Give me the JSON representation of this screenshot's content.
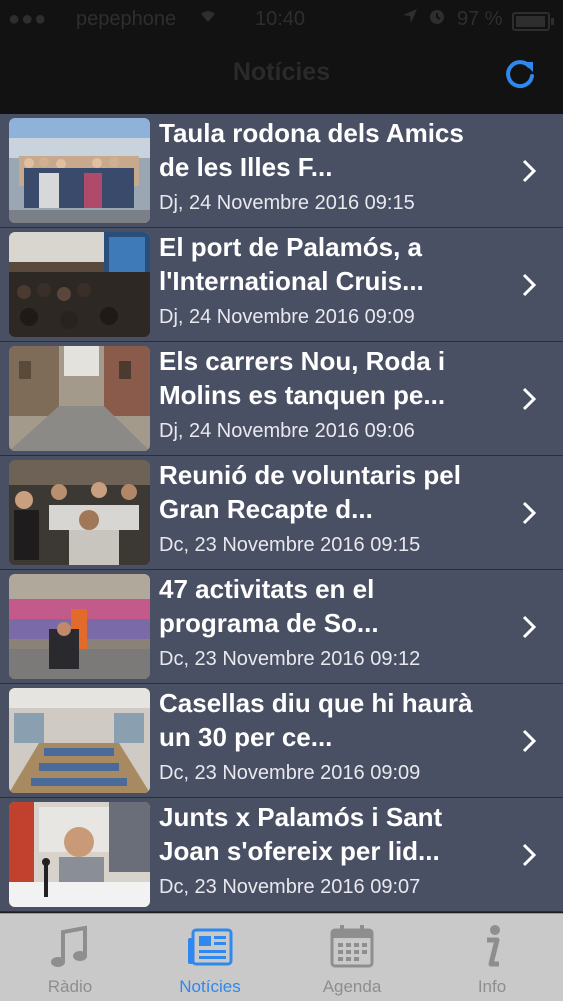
{
  "status_bar": {
    "signal": "●●●",
    "carrier": "pepephone",
    "wifi_icon": "wifi-icon",
    "time": "10:40",
    "location_icon": "location-icon",
    "alarm_icon": "alarm-icon",
    "battery_percent": "97 %",
    "battery_level": 0.97
  },
  "nav": {
    "title": "Notícies",
    "refresh_icon": "refresh-icon"
  },
  "articles": [
    {
      "title": "Taula rodona dels Amics de les Illes F...",
      "date": "Dj, 24 Novembre 2016 09:15",
      "thumb": "group-photo-harbor"
    },
    {
      "title": "El port de Palamós, a l'International Cruis...",
      "date": "Dj, 24 Novembre 2016 09:09",
      "thumb": "conference-audience"
    },
    {
      "title": "Els carrers Nou, Roda i Molins es tanquen pe...",
      "date": "Dj, 24 Novembre 2016 09:06",
      "thumb": "narrow-street"
    },
    {
      "title": "Reunió de voluntaris pel Gran Recapte d...",
      "date": "Dc, 23 Novembre 2016 09:15",
      "thumb": "volunteers-meeting"
    },
    {
      "title": "47 activitats en el programa de So...",
      "date": "Dc, 23 Novembre 2016 09:12",
      "thumb": "dance-parade"
    },
    {
      "title": "Casellas diu que hi haurà un 30 per ce...",
      "date": "Dc, 23 Novembre 2016 09:09",
      "thumb": "dining-hall"
    },
    {
      "title": "Junts x Palamós i Sant Joan s'ofereix per lid...",
      "date": "Dc, 23 Novembre 2016 09:07",
      "thumb": "radio-studio"
    }
  ],
  "tabs": [
    {
      "label": "Ràdio",
      "icon": "music-note-icon",
      "active": false
    },
    {
      "label": "Notícies",
      "icon": "newspaper-icon",
      "active": true
    },
    {
      "label": "Agenda",
      "icon": "calendar-icon",
      "active": false
    },
    {
      "label": "Info",
      "icon": "info-icon",
      "active": false
    }
  ],
  "colors": {
    "accent": "#2f88ee",
    "row_background": "#4a5064",
    "nav_background": "#121212",
    "tab_bar_background": "#c9c9c9"
  }
}
